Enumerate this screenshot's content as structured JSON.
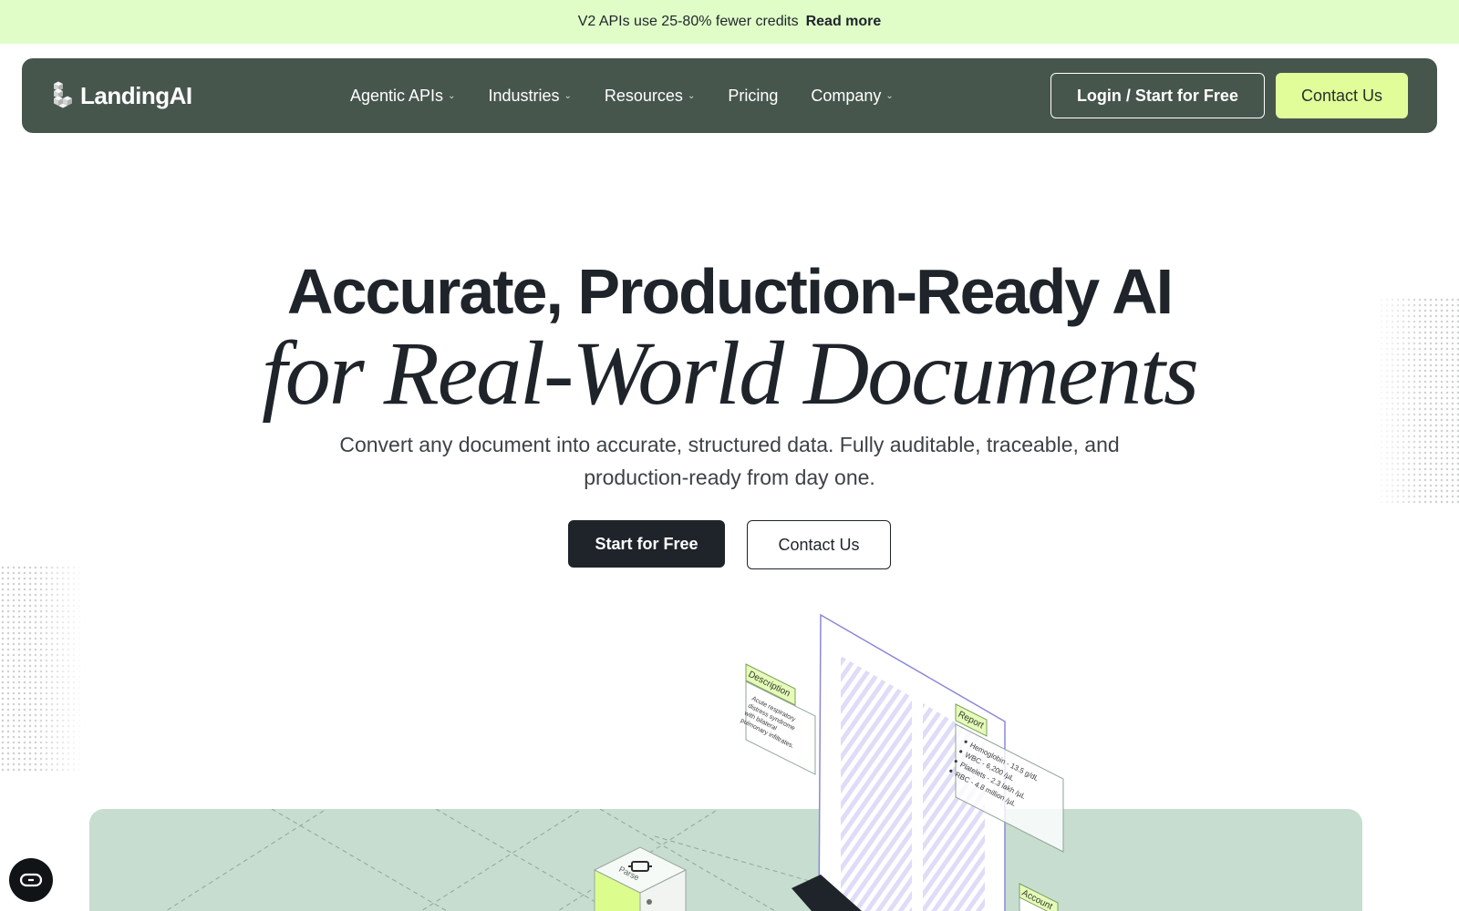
{
  "announcement": {
    "message": "V2 APIs use 25-80% fewer credits",
    "link": "Read more"
  },
  "nav": {
    "logo_text": "LandingAI",
    "menu": [
      {
        "label": "Agentic APIs",
        "has_dropdown": true
      },
      {
        "label": "Industries",
        "has_dropdown": true
      },
      {
        "label": "Resources",
        "has_dropdown": true
      },
      {
        "label": "Pricing",
        "has_dropdown": false
      },
      {
        "label": "Company",
        "has_dropdown": true
      }
    ],
    "login_label": "Login / Start for Free",
    "contact_label": "Contact Us"
  },
  "hero": {
    "title_line1": "Accurate, Production-Ready AI",
    "title_line2": "for Real-World Documents",
    "subtitle": "Convert any document into accurate, structured data. Fully auditable, traceable, and production-ready from day one.",
    "primary_cta": "Start for Free",
    "secondary_cta": "Contact Us"
  },
  "illustration": {
    "description_tag": "Description",
    "description_text": [
      "Acute respiratory",
      "distress syndrome",
      "with bilateral",
      "pulmonary infiltrates."
    ],
    "report_tag": "Report",
    "report_items": [
      "Hemoglobin - 13.5 g/dL",
      "WBC - 6,200 /µL",
      "Platelets - 2.3 lakh /µL",
      "RBC - 4.8 million /µL"
    ],
    "account_tag": "Account",
    "cube_label": "Parse"
  },
  "colors": {
    "announce_bg": "#e0fdc8",
    "nav_bg": "#47564d",
    "accent_lime": "#e0fd9a",
    "dark": "#1f242b",
    "panel_bg": "#c7ddd0",
    "doc_outline": "#8b87d9"
  },
  "icons": {
    "logo": "landingai-logo-icon",
    "dropdown": "chevron-down-icon",
    "chat": "chat-widget-icon"
  }
}
